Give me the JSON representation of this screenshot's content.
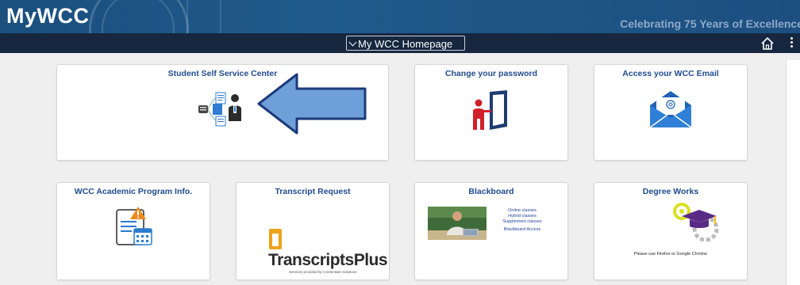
{
  "header": {
    "logo": "MyWCC",
    "tagline": "Celebrating 75 Years of Excellence"
  },
  "navbar": {
    "homepage_select": "My WCC Homepage",
    "home_icon": "home-icon",
    "more_icon": "more-vertical-icon"
  },
  "tiles": {
    "self_service": {
      "title": "Student Self Service Center",
      "icon": "person-documents-icon"
    },
    "password": {
      "title": "Change your password",
      "icon": "door-person-icon"
    },
    "email": {
      "title": "Access your WCC Email",
      "icon": "envelope-icon"
    },
    "academic": {
      "title": "WCC Academic Program Info.",
      "icon": "document-warning-calendar-icon"
    },
    "transcript": {
      "title": "Transcript Request",
      "logo_text": "TranscriptsPlus",
      "logo_sub": "Services provided by Credentials Solutions",
      "icon": "transcript-logo-icon"
    },
    "blackboard": {
      "title": "Blackboard",
      "line1": "Online classes",
      "line2": "Hybrid classes",
      "line3": "Supplement classes",
      "line4": "Blackboard Access",
      "image": "teacher-laptop-photo"
    },
    "degree_works": {
      "title": "Degree Works",
      "note": "Please use Firefox or Google Chrome",
      "icon": "graduation-cap-gears-icon"
    }
  },
  "annotation": {
    "arrow": "left-arrow",
    "color": "#6f9fd8"
  },
  "colors": {
    "banner": "#1f5a8c",
    "navbar": "#16273f",
    "tile_title": "#1f4b8f",
    "background": "#efefef"
  }
}
